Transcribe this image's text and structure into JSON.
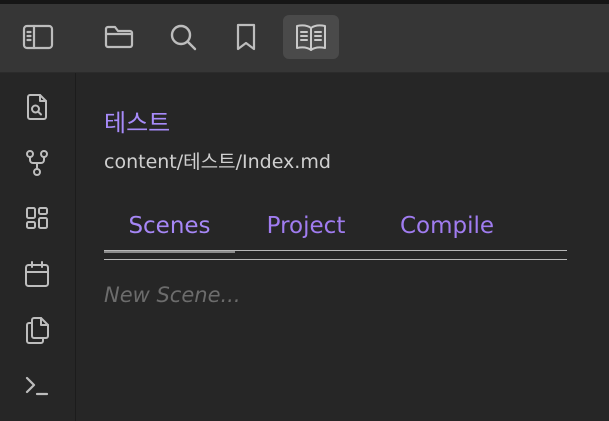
{
  "toolbar": {
    "buttons": [
      {
        "icon": "sidebar-toggle-icon"
      },
      {
        "icon": "folder-icon"
      },
      {
        "icon": "search-icon"
      },
      {
        "icon": "bookmark-icon"
      },
      {
        "icon": "book-open-icon",
        "active": true
      }
    ]
  },
  "ribbon": {
    "items": [
      {
        "icon": "file-search-icon"
      },
      {
        "icon": "graph-icon"
      },
      {
        "icon": "dashboard-grid-icon"
      },
      {
        "icon": "calendar-icon"
      },
      {
        "icon": "copy-files-icon"
      },
      {
        "icon": "terminal-icon"
      }
    ]
  },
  "panel": {
    "title": "테스트",
    "path": "content/테스트/Index.md",
    "tabs": [
      "Scenes",
      "Project",
      "Compile"
    ],
    "active_tab": "Scenes",
    "new_scene_placeholder": "New Scene..."
  },
  "colors": {
    "accent": "#a78bfa",
    "background": "#262626",
    "toolbar": "#363636"
  }
}
